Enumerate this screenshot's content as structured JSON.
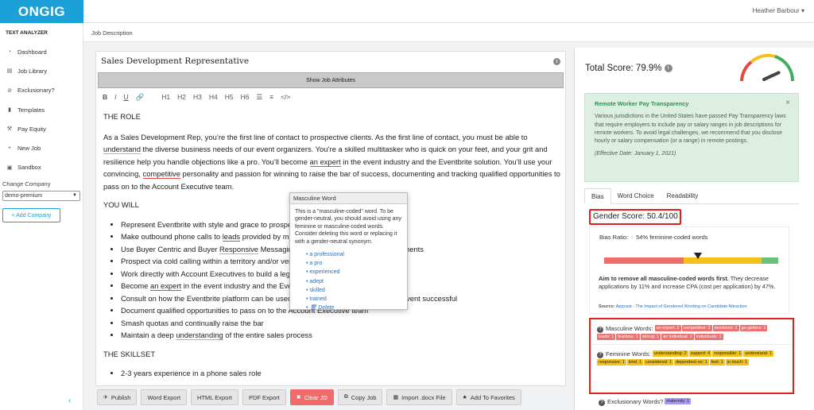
{
  "app": {
    "logo": "ONGIG",
    "user": "Heather Barbour ▾"
  },
  "sidebar": {
    "title": "TEXT ANALYZER",
    "items": [
      {
        "label": "Dashboard",
        "icon": "dashboard-icon"
      },
      {
        "label": "Job Library",
        "icon": "document-icon"
      },
      {
        "label": "Exclusionary?",
        "icon": "prohibited-icon"
      },
      {
        "label": "Templates",
        "icon": "file-icon"
      },
      {
        "label": "Pay Equity",
        "icon": "gavel-icon"
      },
      {
        "label": "New Job",
        "icon": "plus-icon"
      },
      {
        "label": "Sandbox",
        "icon": "sandbox-icon"
      }
    ],
    "change_company_label": "Change Company",
    "company_value": "demo-premium",
    "add_company": "+ Add Company",
    "collapse": "‹"
  },
  "breadcrumb": "Job Description",
  "editor": {
    "title": "Sales Development Representative",
    "show_attributes": "Show Job Attributes",
    "toolbar": [
      "B",
      "I",
      "U",
      "🔗",
      "H1",
      "H2",
      "H3",
      "H4",
      "H5",
      "H6",
      "☰",
      "≡",
      "</>"
    ],
    "heading_role": "THE ROLE",
    "role_p": {
      "a": "As a Sales Development Rep, you’re the first line of contact to prospective clients.  As the first line of contact, you must be able to ",
      "w_understand": "understand",
      "b": " the diverse business needs of our event organizers. You’re a skilled multitasker who is quick on your feet, and your grit and resilience help you handle objections like a pro.  You’ll become ",
      "w_an_expert": "an expert",
      "c": " in the event industry and the Eventbrite solution. You’ll use your convincing, ",
      "w_competitive": "competitive",
      "d": " personality and passion for winning to raise the bar of success, documenting and tracking qualified opportunities to pass on to the Account Executive team."
    },
    "heading_you_will": "YOU WILL",
    "bullets": [
      {
        "a": "Represent Eventbrite with style and grace to prospects",
        "w": "",
        "b": ""
      },
      {
        "a": "Make outbound phone calls to ",
        "w": "leads",
        "b": " provided by marketing"
      },
      {
        "a": "Use Buyer Centric and Buyer ",
        "w": "Responsive",
        "b": " Messaging to engage various business segments"
      },
      {
        "a": "Prospect via cold calling within a territory and/or vertical",
        "w": "",
        "b": ""
      },
      {
        "a": "Work directly with Account Executives to build a legion of opportunities",
        "w": "",
        "b": ""
      },
      {
        "a": "Become ",
        "w": "an expert",
        "b": " in the event industry and the Eventbrite platform"
      },
      {
        "a": "Consult on how the Eventbrite platform can be used by event creators to make every event successful",
        "w": "",
        "b": ""
      },
      {
        "a": "Document qualified opportunities to pass on to the Account Executive team",
        "w": "",
        "b": ""
      },
      {
        "a": "Smash quotas and continually raise the bar",
        "w": "",
        "b": ""
      },
      {
        "a": "Maintain a deep ",
        "w": "understanding",
        "b": " of the entire sales process"
      }
    ],
    "heading_skillset": "THE SKILLSET",
    "skill_bullets": [
      "2-3 years experience in a phone sales role"
    ]
  },
  "tooltip": {
    "header": "Masculine Word",
    "body": "This is a \"masculine-coded\" word. To be gender-neutral, you should avoid using any feminine or masculine-coded words. Consider deleting this word or replacing it with a gender-neutral synonym.",
    "options": [
      "a professional",
      "a pro",
      "experienced",
      "adept",
      "skilled",
      "trained"
    ],
    "delete": "🗑 Delete"
  },
  "buttons": [
    {
      "label": "Publish",
      "icon": "✈"
    },
    {
      "label": "Word Export",
      "icon": ""
    },
    {
      "label": "HTML Export",
      "icon": ""
    },
    {
      "label": "PDF Export",
      "icon": ""
    },
    {
      "label": "Clear JD",
      "icon": "✖"
    },
    {
      "label": "Copy Job",
      "icon": "⧉"
    },
    {
      "label": "Import .docx File",
      "icon": "▦"
    },
    {
      "label": "Add To Favorites",
      "icon": "★"
    }
  ],
  "right": {
    "total_score": "Total Score: 79.9%",
    "gauge_value": 0.8,
    "notice": {
      "title": "Remote Worker Pay Transparency",
      "text": "Various jurisdictions in the United States have passed Pay Transparency laws that require employers to include pay or salary ranges in job descriptions for remote workers. To avoid legal challenges, we recommend that you disclose hourly or salary compensation (or a range) in remote postings.",
      "effective": "(Effective Date: January 1, 2021)",
      "close": "×"
    },
    "tabs": [
      "Bias",
      "Word Choice",
      "Readability"
    ],
    "gender_score": "Gender Score: 50.4/100",
    "bias_ratio_label": "Bias Ratio:",
    "bias_ratio_value": "54% feminine-coded words",
    "bias_marker": 0.54,
    "aim_bold": "Aim to remove all masculine-coded words first.",
    "aim_rest": " They decrease applications by 11% and increase CPA (cost per application) by 47%.",
    "source_label": "Source:",
    "source_link": "Appcast - The Impact of Gendered Wording on Candidate Attraction",
    "masculine_label": "Masculine Words:",
    "masculine_tags": [
      "an expert: 2",
      "competitive: 2",
      "decisions: 2",
      "go-getters: 1",
      "leads: 1",
      "fearless: 1",
      "strong: 1",
      "an individual: 1",
      "individuals: 1"
    ],
    "feminine_label": "Feminine Words:",
    "feminine_tags": [
      "understanding: 2",
      "support: 4",
      "responsible: 1",
      "understand: 1",
      "responsive: 1",
      "kind: 1",
      "considered: 1",
      "dependent on: 1",
      "feel: 1",
      "in touch: 1"
    ],
    "exclusionary_label": "Exclusionary Words?",
    "exclusionary_tags": [
      "maternity: 1"
    ]
  }
}
